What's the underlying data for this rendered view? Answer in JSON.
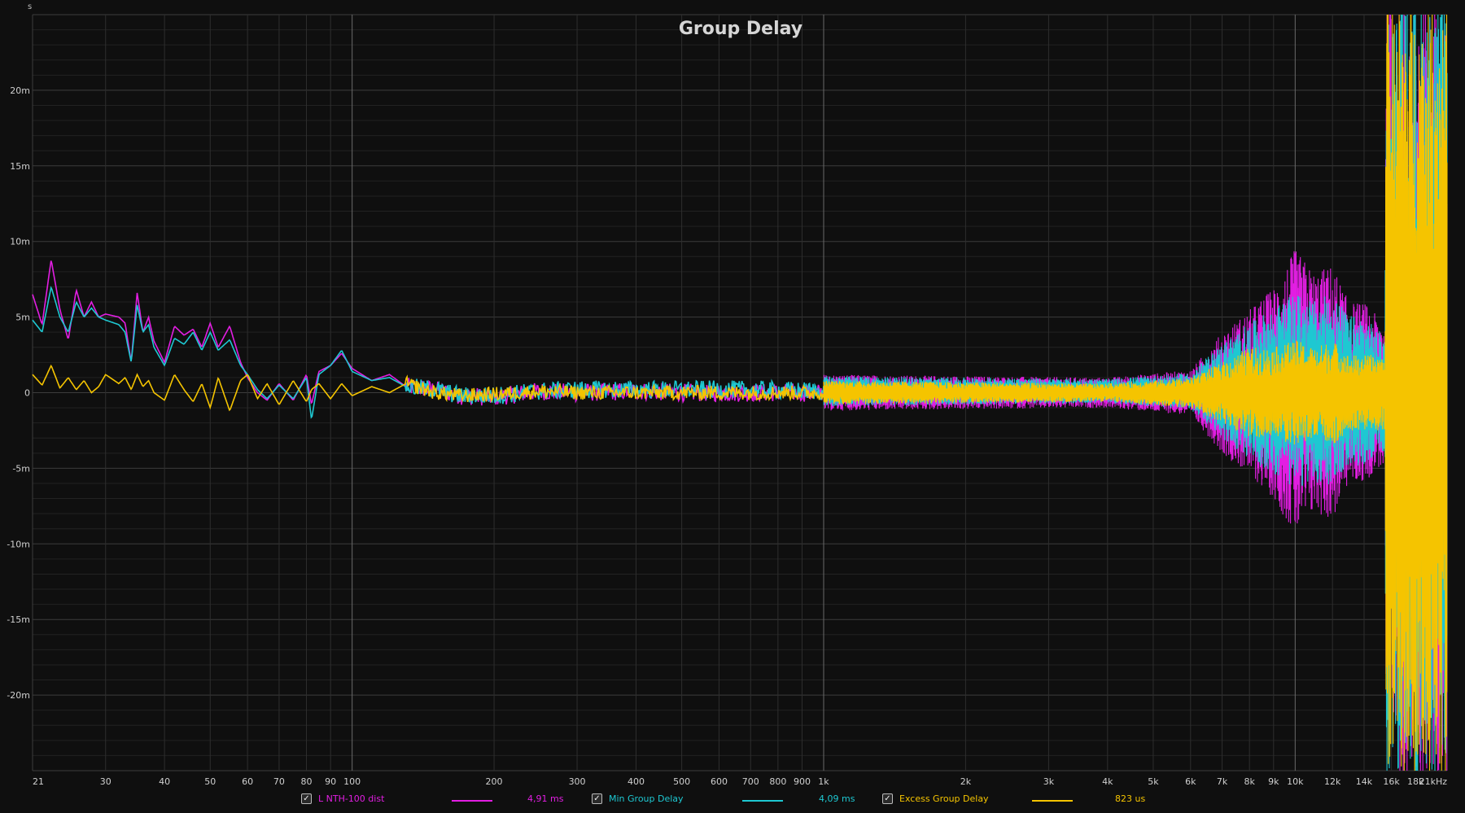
{
  "chart_data": {
    "type": "line",
    "title": "Group Delay",
    "y_unit": "s",
    "x_scale": "log",
    "xlim": [
      21,
      21000
    ],
    "ylim": [
      -0.025,
      0.025
    ],
    "grid": true,
    "x_ticks": [
      {
        "v": 21,
        "label": "21"
      },
      {
        "v": 30,
        "label": "30"
      },
      {
        "v": 40,
        "label": "40"
      },
      {
        "v": 50,
        "label": "50"
      },
      {
        "v": 60,
        "label": "60"
      },
      {
        "v": 70,
        "label": "70"
      },
      {
        "v": 80,
        "label": "80"
      },
      {
        "v": 90,
        "label": "90"
      },
      {
        "v": 100,
        "label": "100"
      },
      {
        "v": 200,
        "label": "200"
      },
      {
        "v": 300,
        "label": "300"
      },
      {
        "v": 400,
        "label": "400"
      },
      {
        "v": 500,
        "label": "500"
      },
      {
        "v": 600,
        "label": "600"
      },
      {
        "v": 700,
        "label": "700"
      },
      {
        "v": 800,
        "label": "800"
      },
      {
        "v": 900,
        "label": "900"
      },
      {
        "v": 1000,
        "label": "1k"
      },
      {
        "v": 2000,
        "label": "2k"
      },
      {
        "v": 3000,
        "label": "3k"
      },
      {
        "v": 4000,
        "label": "4k"
      },
      {
        "v": 5000,
        "label": "5k"
      },
      {
        "v": 6000,
        "label": "6k"
      },
      {
        "v": 7000,
        "label": "7k"
      },
      {
        "v": 8000,
        "label": "8k"
      },
      {
        "v": 9000,
        "label": "9k"
      },
      {
        "v": 10000,
        "label": "10k"
      },
      {
        "v": 12000,
        "label": "12k"
      },
      {
        "v": 14000,
        "label": "14k"
      },
      {
        "v": 16000,
        "label": "16k"
      },
      {
        "v": 18000,
        "label": "18k"
      },
      {
        "v": 21000,
        "label": "21kHz"
      }
    ],
    "y_ticks": [
      {
        "v": 0.02,
        "label": "20m"
      },
      {
        "v": 0.015,
        "label": "15m"
      },
      {
        "v": 0.01,
        "label": "10m"
      },
      {
        "v": 0.005,
        "label": "5m"
      },
      {
        "v": 0,
        "label": "0"
      },
      {
        "v": -0.005,
        "label": "-5m"
      },
      {
        "v": -0.01,
        "label": "-10m"
      },
      {
        "v": -0.015,
        "label": "-15m"
      },
      {
        "v": -0.02,
        "label": "-20m"
      }
    ],
    "series": [
      {
        "name": "L NTH-100 dist",
        "color": "#e21ee2",
        "legend_value": "4,91 ms",
        "checked": true,
        "x": [
          21,
          22,
          23,
          24,
          25,
          26,
          27,
          28,
          29,
          30,
          32,
          33,
          34,
          35,
          36,
          37,
          38,
          40,
          42,
          44,
          46,
          48,
          50,
          52,
          55,
          58,
          60,
          63,
          66,
          70,
          75,
          80,
          82,
          85,
          90,
          95,
          100,
          110,
          120,
          130,
          150,
          170,
          200,
          250,
          300,
          400,
          500,
          700,
          1000,
          1500,
          2000,
          3000,
          4000,
          5000,
          6000,
          7000,
          8000,
          9000,
          10000,
          11000,
          12000,
          13000,
          14000,
          15000,
          15600,
          16000,
          17000,
          18000,
          19000,
          20000,
          21000
        ],
        "y": [
          0.0065,
          0.0045,
          0.0088,
          0.0055,
          0.0035,
          0.0068,
          0.005,
          0.006,
          0.005,
          0.0052,
          0.005,
          0.0046,
          0.002,
          0.0066,
          0.004,
          0.005,
          0.0034,
          0.002,
          0.0044,
          0.0038,
          0.0042,
          0.003,
          0.0046,
          0.003,
          0.0044,
          0.002,
          0.001,
          0.0,
          -0.0005,
          0.0006,
          -0.0005,
          0.0012,
          -0.0008,
          0.0014,
          0.0018,
          0.0026,
          0.0016,
          0.0008,
          0.0012,
          0.0004,
          0.0002,
          -0.0002,
          -0.0003,
          0.0001,
          0.0,
          0.0001,
          0.0,
          0.0,
          0.0,
          0.0,
          0.0,
          0.0,
          0.0,
          0.0,
          0.0,
          0.0,
          0.0,
          0.0,
          0.0,
          0.0,
          0.0,
          0.0,
          0.0,
          0.0,
          0.0,
          0.0,
          0.0,
          0.0,
          0.0,
          0.0,
          0.0
        ],
        "spread_x": [
          1000,
          4000,
          6000,
          7000,
          8000,
          9000,
          10000,
          11000,
          12000,
          13000,
          14000,
          15000,
          15500,
          15600,
          21000
        ],
        "spread": [
          0.0012,
          0.001,
          0.0015,
          0.004,
          0.0055,
          0.007,
          0.0095,
          0.008,
          0.0085,
          0.006,
          0.006,
          0.005,
          0.005,
          0.026,
          0.026
        ]
      },
      {
        "name": "Min Group Delay",
        "color": "#1ec8d2",
        "legend_value": "4,09 ms",
        "checked": true,
        "x": [
          21,
          22,
          23,
          24,
          25,
          26,
          27,
          28,
          29,
          30,
          32,
          33,
          34,
          35,
          36,
          37,
          38,
          40,
          42,
          44,
          46,
          48,
          50,
          52,
          55,
          58,
          60,
          63,
          66,
          70,
          75,
          80,
          82,
          85,
          90,
          95,
          100,
          110,
          120,
          130,
          150,
          170,
          200,
          250,
          300,
          400,
          500,
          700,
          1000,
          1500,
          2000,
          3000,
          4000,
          5000,
          6000,
          7000,
          8000,
          9000,
          10000,
          11000,
          12000,
          13000,
          14000,
          15000,
          15600,
          16000,
          17000,
          18000,
          19000,
          20000,
          21000
        ],
        "y": [
          0.0048,
          0.004,
          0.007,
          0.005,
          0.004,
          0.006,
          0.005,
          0.0056,
          0.005,
          0.0048,
          0.0045,
          0.004,
          0.002,
          0.0058,
          0.004,
          0.0045,
          0.003,
          0.0018,
          0.0036,
          0.0032,
          0.004,
          0.0028,
          0.004,
          0.0028,
          0.0035,
          0.0018,
          0.0012,
          0.0002,
          -0.0004,
          0.0005,
          -0.0004,
          0.001,
          -0.0018,
          0.0012,
          0.0018,
          0.0028,
          0.0014,
          0.0008,
          0.001,
          0.0004,
          0.0002,
          -0.0002,
          -0.0002,
          0.0001,
          0.0002,
          0.0002,
          0.0002,
          0.0002,
          0.0001,
          0.0001,
          0.0001,
          0.0001,
          0.0001,
          0.0001,
          0.0001,
          0.0001,
          0.0001,
          0.0001,
          0.0001,
          0.0001,
          0.0001,
          0.0001,
          0.0001,
          0.0001,
          0.0,
          0.0,
          0.0,
          0.0,
          0.0,
          0.0,
          0.0
        ],
        "spread_x": [
          1000,
          4000,
          6000,
          7000,
          8000,
          9000,
          10000,
          11000,
          12000,
          13000,
          14000,
          15000,
          15500,
          15600,
          21000
        ],
        "spread": [
          0.001,
          0.0008,
          0.0012,
          0.0032,
          0.0045,
          0.0055,
          0.0065,
          0.006,
          0.0065,
          0.005,
          0.005,
          0.004,
          0.004,
          0.026,
          0.026
        ]
      },
      {
        "name": "Excess Group Delay",
        "color": "#f5c400",
        "legend_value": "823 us",
        "checked": true,
        "x": [
          21,
          22,
          23,
          24,
          25,
          26,
          27,
          28,
          29,
          30,
          32,
          33,
          34,
          35,
          36,
          37,
          38,
          40,
          42,
          44,
          46,
          48,
          50,
          52,
          55,
          58,
          60,
          63,
          66,
          70,
          75,
          80,
          82,
          85,
          90,
          95,
          100,
          110,
          120,
          130,
          150,
          170,
          200,
          250,
          300,
          400,
          500,
          700,
          1000,
          1500,
          2000,
          3000,
          4000,
          5000,
          6000,
          7000,
          8000,
          9000,
          10000,
          11000,
          12000,
          13000,
          14000,
          15000,
          15600,
          16000,
          17000,
          18000,
          19000,
          20000,
          21000
        ],
        "y": [
          0.0012,
          0.0005,
          0.0018,
          0.0003,
          0.001,
          0.0002,
          0.0008,
          0.0,
          0.0004,
          0.0012,
          0.0006,
          0.001,
          0.0002,
          0.0012,
          0.0004,
          0.0008,
          0.0,
          -0.0005,
          0.0012,
          0.0002,
          -0.0006,
          0.0006,
          -0.001,
          0.001,
          -0.0012,
          0.0008,
          0.0012,
          -0.0004,
          0.0006,
          -0.0008,
          0.0008,
          -0.0006,
          0.0002,
          0.0006,
          -0.0004,
          0.0006,
          -0.0002,
          0.0004,
          0.0,
          0.0006,
          0.0,
          -0.0002,
          -0.0001,
          0.0001,
          0.0,
          0.0,
          0.0,
          0.0,
          0.0,
          0.0,
          0.0,
          0.0,
          0.0,
          0.0,
          0.0,
          0.0,
          0.0,
          0.0,
          0.0,
          0.0,
          0.0,
          0.0,
          0.0,
          0.0,
          0.0,
          0.0,
          0.0,
          0.0,
          0.0,
          0.0,
          0.0
        ],
        "spread_x": [
          1000,
          4000,
          6000,
          7000,
          8000,
          9000,
          10000,
          11000,
          12000,
          13000,
          14000,
          15000,
          15500,
          15600,
          21000
        ],
        "spread": [
          0.0008,
          0.0006,
          0.001,
          0.002,
          0.003,
          0.003,
          0.0035,
          0.003,
          0.0035,
          0.0025,
          0.0025,
          0.0025,
          0.0025,
          0.026,
          0.026
        ]
      }
    ]
  }
}
